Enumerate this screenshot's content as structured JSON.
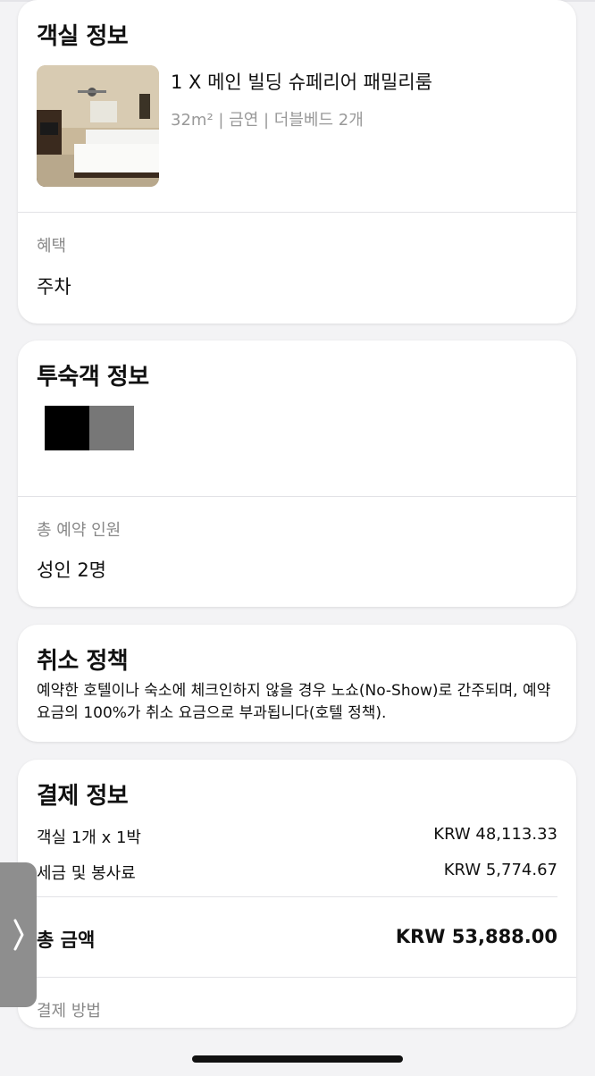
{
  "room": {
    "title": "객실 정보",
    "name": "1 X 메인 빌딩 슈페리어 패밀리룸",
    "meta": "32m² | 금연 | 더블베드 2개",
    "benefit_label": "혜택",
    "benefit_value": "주차"
  },
  "guest": {
    "title": "투숙객 정보",
    "total_label": "총 예약 인원",
    "total_value": "성인 2명"
  },
  "policy": {
    "title": "취소 정책",
    "text": "예약한 호텔이나 숙소에 체크인하지 않을 경우 노쇼(No-Show)로 간주되며, 예약 요금의 100%가 취소 요금으로 부과됩니다(호텔 정책)."
  },
  "payment": {
    "title": "결제 정보",
    "rows": [
      {
        "label": "객실 1개 x 1박",
        "amount": "KRW 48,113.33"
      },
      {
        "label": "세금 및 봉사료",
        "amount": "KRW 5,774.67"
      }
    ],
    "total_label": "총 금액",
    "total_amount": "KRW 53,888.00",
    "method_label": "결제 방법"
  },
  "icons": {
    "edge_tab": "chevron-right-icon"
  }
}
